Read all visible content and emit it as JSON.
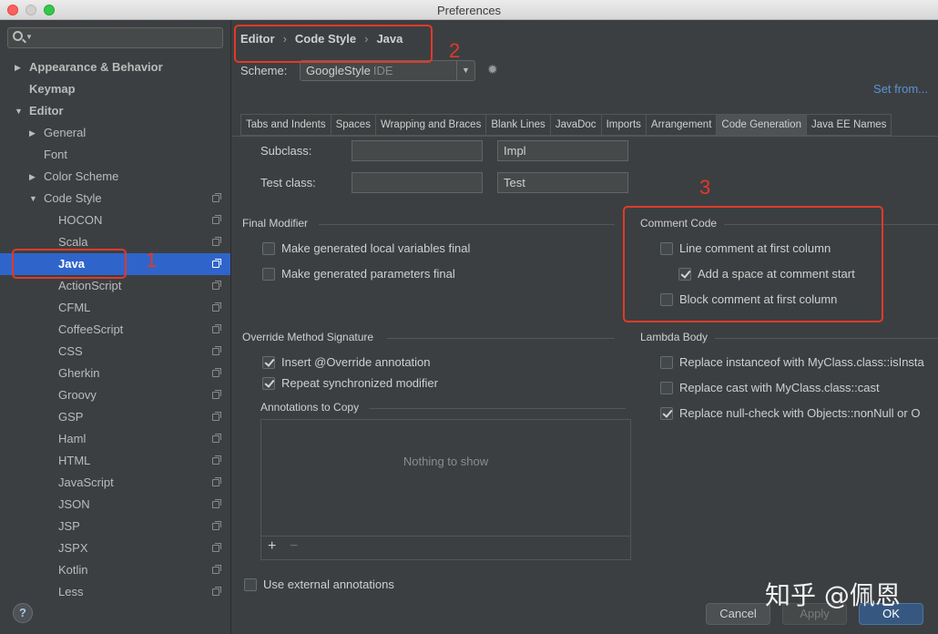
{
  "window": {
    "title": "Preferences"
  },
  "sidebar": {
    "search_placeholder": "",
    "items": [
      {
        "label": "Appearance & Behavior",
        "level": 0,
        "arrow": "▶",
        "bold": true
      },
      {
        "label": "Keymap",
        "level": 0,
        "arrow": "",
        "bold": true
      },
      {
        "label": "Editor",
        "level": 0,
        "arrow": "▼",
        "bold": true
      },
      {
        "label": "General",
        "level": 1,
        "arrow": "▶"
      },
      {
        "label": "Font",
        "level": 1,
        "arrow": ""
      },
      {
        "label": "Color Scheme",
        "level": 1,
        "arrow": "▶"
      },
      {
        "label": "Code Style",
        "level": 1,
        "arrow": "▼",
        "copy": true
      },
      {
        "label": "HOCON",
        "level": 2,
        "copy": true
      },
      {
        "label": "Scala",
        "level": 2,
        "copy": true
      },
      {
        "label": "Java",
        "level": 2,
        "copy": true,
        "selected": true
      },
      {
        "label": "ActionScript",
        "level": 2,
        "copy": true
      },
      {
        "label": "CFML",
        "level": 2,
        "copy": true
      },
      {
        "label": "CoffeeScript",
        "level": 2,
        "copy": true
      },
      {
        "label": "CSS",
        "level": 2,
        "copy": true
      },
      {
        "label": "Gherkin",
        "level": 2,
        "copy": true
      },
      {
        "label": "Groovy",
        "level": 2,
        "copy": true
      },
      {
        "label": "GSP",
        "level": 2,
        "copy": true
      },
      {
        "label": "Haml",
        "level": 2,
        "copy": true
      },
      {
        "label": "HTML",
        "level": 2,
        "copy": true
      },
      {
        "label": "JavaScript",
        "level": 2,
        "copy": true
      },
      {
        "label": "JSON",
        "level": 2,
        "copy": true
      },
      {
        "label": "JSP",
        "level": 2,
        "copy": true
      },
      {
        "label": "JSPX",
        "level": 2,
        "copy": true
      },
      {
        "label": "Kotlin",
        "level": 2,
        "copy": true
      },
      {
        "label": "Less",
        "level": 2,
        "copy": true
      }
    ],
    "help_label": "?"
  },
  "breadcrumb": {
    "items": [
      "Editor",
      "Code Style",
      "Java"
    ],
    "separator": "›"
  },
  "scheme": {
    "label": "Scheme:",
    "value": "GoogleStyle",
    "suffix": "IDE",
    "gear": "✹",
    "set_from": "Set from..."
  },
  "tabs": [
    {
      "label": "Tabs and Indents"
    },
    {
      "label": "Spaces"
    },
    {
      "label": "Wrapping and Braces"
    },
    {
      "label": "Blank Lines"
    },
    {
      "label": "JavaDoc"
    },
    {
      "label": "Imports"
    },
    {
      "label": "Arrangement"
    },
    {
      "label": "Code Generation",
      "active": true
    },
    {
      "label": "Java EE Names"
    }
  ],
  "naming": {
    "subclass_label": "Subclass:",
    "subclass_prefix": "",
    "subclass_suffix": "Impl",
    "test_label": "Test class:",
    "test_prefix": "",
    "test_suffix": "Test"
  },
  "final_modifier": {
    "title": "Final Modifier",
    "options": [
      {
        "label": "Make generated local variables final",
        "checked": false
      },
      {
        "label": "Make generated parameters final",
        "checked": false
      }
    ]
  },
  "comment_code": {
    "title": "Comment Code",
    "options": [
      {
        "label": "Line comment at first column",
        "checked": false
      },
      {
        "label": "Add a space at comment start",
        "checked": true
      },
      {
        "label": "Block comment at first column",
        "checked": false
      }
    ]
  },
  "override": {
    "title": "Override Method Signature",
    "options": [
      {
        "label": "Insert @Override annotation",
        "checked": true
      },
      {
        "label": "Repeat synchronized modifier",
        "checked": true
      }
    ],
    "annotations_title": "Annotations to Copy",
    "empty_text": "Nothing to show",
    "add": "+",
    "remove": "−"
  },
  "lambda": {
    "title": "Lambda Body",
    "options": [
      {
        "label": "Replace instanceof with MyClass.class::isInsta",
        "checked": false
      },
      {
        "label": "Replace cast with MyClass.class::cast",
        "checked": false
      },
      {
        "label": "Replace null-check with Objects::nonNull or O",
        "checked": true
      }
    ]
  },
  "external": {
    "label": "Use external annotations",
    "checked": false
  },
  "buttons": {
    "cancel": "Cancel",
    "apply": "Apply",
    "ok": "OK"
  },
  "watermark": "知乎 @佩恩",
  "annotations": {
    "n1": "1",
    "n2": "2",
    "n3": "3"
  },
  "colors": {
    "accent": "#2f65ca",
    "annotation_red": "#e03a2a",
    "link": "#5894d6"
  }
}
